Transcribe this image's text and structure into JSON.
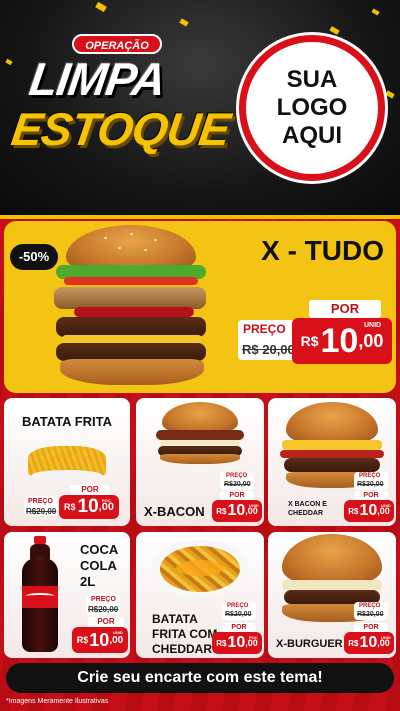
{
  "header": {
    "campaign_badge": "OPERAÇÃO",
    "campaign_line1": "LIMPA",
    "campaign_line2": "ESTOQUE",
    "logo_lines": [
      "SUA",
      "LOGO",
      "AQUI"
    ]
  },
  "featured": {
    "discount": "-50%",
    "name": "X - TUDO",
    "old_label": "PREÇO",
    "old_price": "R$ 20,00",
    "por_label": "POR",
    "new_currency": "R$",
    "new_price": "10",
    "new_cents": ",00",
    "unit": "UNID"
  },
  "products": [
    {
      "name": "BATATA FRITA",
      "old_label": "PREÇO",
      "old_price": "R$20,00",
      "por_label": "POR",
      "currency": "R$",
      "price": "10",
      "cents": ",00",
      "unit": "POC"
    },
    {
      "name": "X-BACON",
      "old_label": "PREÇO",
      "old_price": "R$20,00",
      "por_label": "POR",
      "currency": "R$",
      "price": "10",
      "cents": ",00",
      "unit": "UNID"
    },
    {
      "name": "X BACON E CHEDDAR",
      "old_label": "PREÇO",
      "old_price": "R$20,00",
      "por_label": "POR",
      "currency": "R$",
      "price": "10",
      "cents": ",00",
      "unit": "UNID"
    },
    {
      "name": "COCA COLA 2L",
      "old_label": "PREÇO",
      "old_price": "R$20,00",
      "por_label": "POR",
      "currency": "R$",
      "price": "10",
      "cents": ",00",
      "unit": "UNID"
    },
    {
      "name": "BATATA FRITA COM CHEDDAR",
      "old_label": "PREÇO",
      "old_price": "R$20,00",
      "por_label": "POR",
      "currency": "R$",
      "price": "10",
      "cents": ",00",
      "unit": "POC"
    },
    {
      "name": "X-BURGUER",
      "old_label": "PREÇO",
      "old_price": "R$20,00",
      "por_label": "POR",
      "currency": "R$",
      "price": "10",
      "cents": ",00",
      "unit": "UNID"
    }
  ],
  "footer": {
    "cta": "Crie seu encarte com este tema!",
    "disclaimer": "*Imagens Meramente Ilustrativas"
  },
  "colors": {
    "brand_red": "#d8101a",
    "brand_yellow": "#f3c414",
    "dark": "#111111"
  }
}
